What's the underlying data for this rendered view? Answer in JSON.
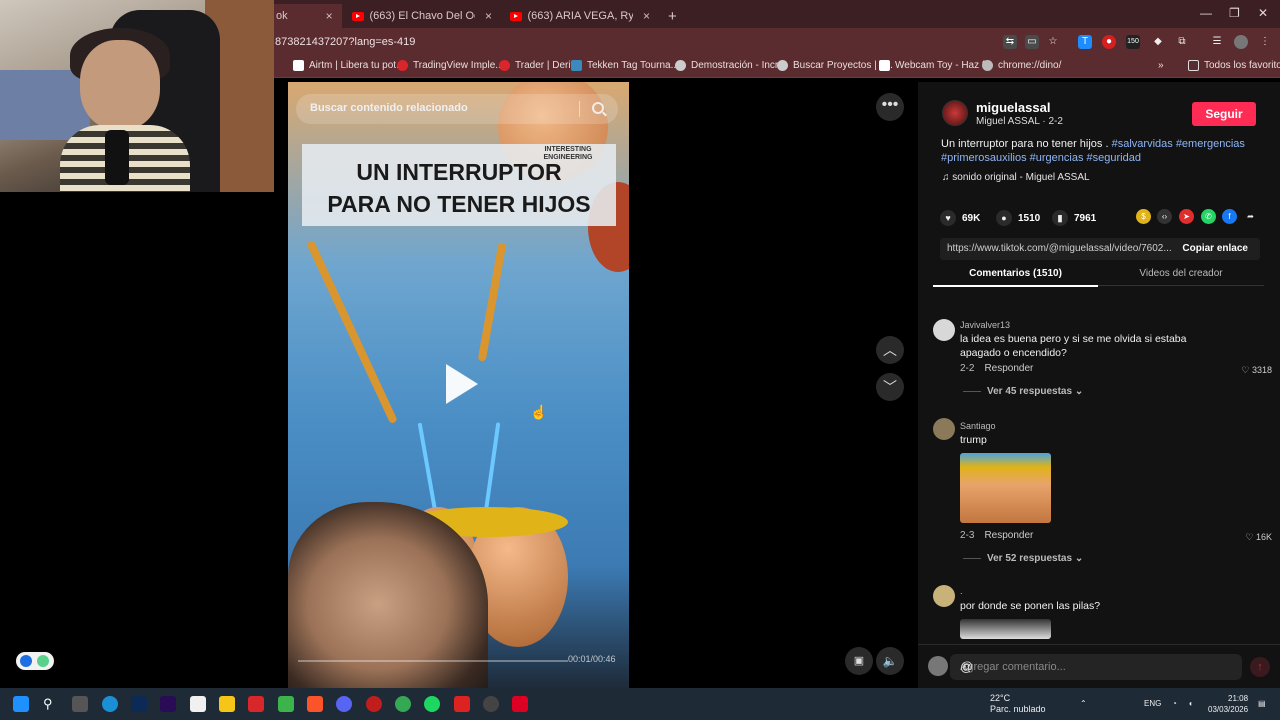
{
  "browser": {
    "tabs": [
      {
        "title": "ok"
      },
      {
        "title": "(663) El Chavo Del Ocho - Intro"
      },
      {
        "title": "(663) ARIA VEGA, Ryan Castro"
      }
    ],
    "new_tab": "+",
    "url": "873821437207?lang=es-419",
    "bookmarks": [
      "Airtm | Libera tu pot...",
      "TradingView Imple...",
      "Trader | Deriv",
      "Tekken Tag Tourna...",
      "Demostración - Incr...",
      "Buscar Proyectos | F...",
      "Webcam Toy - Haz f...",
      "chrome://dino/"
    ],
    "all_bookmarks": "Todos los favoritos",
    "ext_badge": "150"
  },
  "video": {
    "search_placeholder": "Buscar contenido relacionado",
    "title_line1": "UN INTERRUPTOR",
    "title_line2": "PARA NO TENER HIJOS",
    "brand": "INTERESTING ENGINEERING",
    "time": "00:01/00:46"
  },
  "post": {
    "username": "miguelassal",
    "subtitle": "Miguel ASSAL · 2-2",
    "follow": "Seguir",
    "description": "Un interruptor para no tener hijos .",
    "hashtags": [
      "#salvarvidas",
      "#emergencias",
      "#primerosauxilios",
      "#urgencias",
      "#seguridad"
    ],
    "sound": "sonido original - Miguel ASSAL",
    "likes": "69K",
    "comments_count": "1510",
    "saves": "7961",
    "link": "https://www.tiktok.com/@miguelassal/video/7602...",
    "copy_link": "Copiar enlace",
    "tab_comments": "Comentarios (1510)",
    "tab_creator": "Videos del creador"
  },
  "comments": [
    {
      "user": "Javivalver13",
      "text": "la idea es buena pero y si se me olvida si estaba apagado o encendido?",
      "date": "2-2",
      "reply": "Responder",
      "likes": "3318",
      "more": "Ver 45 respuestas"
    },
    {
      "user": "Santiago",
      "text": "trump",
      "date": "2-3",
      "reply": "Responder",
      "likes": "16K",
      "more": "Ver 52 respuestas"
    },
    {
      "user": ".",
      "text": "por donde se ponen las pilas?"
    }
  ],
  "comment_input_placeholder": "Agregar comentario...",
  "taskbar": {
    "weather_temp": "22°C",
    "weather_desc": "Parc. nublado",
    "lang": "ENG",
    "time": "21:08",
    "date": "03/03/2026"
  },
  "colors": {
    "follow": "#fe2c55",
    "hashtag": "#8fb6f5",
    "chrome_tab": "#3c1f22",
    "chrome_bar": "#5a2b2f"
  }
}
